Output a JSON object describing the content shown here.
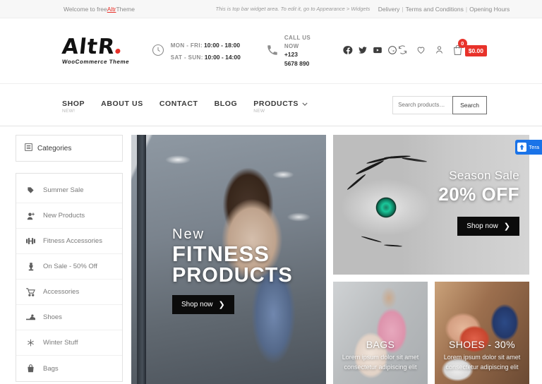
{
  "topbar": {
    "left_prefix": "Welcome to free ",
    "left_link": "Altr",
    "left_suffix": " Theme",
    "middle": "This is top bar widget area. To edit it, go to Appearance > Widgets",
    "links": [
      "Delivery",
      "Terms and Conditions",
      "Opening Hours"
    ]
  },
  "header": {
    "logo_main": "AltR",
    "logo_sub": "WooCommerce Theme",
    "hours": {
      "row1_label": "MON - FRI:",
      "row1_value": "10:00 - 18:00",
      "row2_label": "SAT - SUN:",
      "row2_value": "10:00 - 14:00"
    },
    "phone": {
      "label": "CALL US NOW",
      "value": "+123 5678 890"
    },
    "socials": [
      "facebook-icon",
      "twitter-icon",
      "youtube-icon",
      "whatsapp-icon"
    ],
    "actions": {
      "compare": "compare-icon",
      "wishlist": "heart-icon",
      "account": "user-icon",
      "cart": "cart-icon",
      "cart_count": "0",
      "cart_total": "$0.00"
    }
  },
  "nav": {
    "items": [
      {
        "label": "SHOP",
        "badge": "NEW!",
        "dropdown": false
      },
      {
        "label": "ABOUT US",
        "badge": "",
        "dropdown": false
      },
      {
        "label": "CONTACT",
        "badge": "",
        "dropdown": false
      },
      {
        "label": "BLOG",
        "badge": "",
        "dropdown": false
      },
      {
        "label": "PRODUCTS",
        "badge": "NEW",
        "dropdown": true
      }
    ],
    "chevron": "⌄"
  },
  "search": {
    "placeholder": "Search products…",
    "value": "",
    "button": "Search"
  },
  "sidebar": {
    "header": "Categories",
    "header_icon": "list-icon",
    "items": [
      {
        "label": "Summer Sale",
        "icon": "tag-icon",
        "glyph": "⚑"
      },
      {
        "label": "New Products",
        "icon": "user-plus-icon",
        "glyph": "♟"
      },
      {
        "label": "Fitness Accessories",
        "icon": "dumbbell-icon",
        "glyph": "‖"
      },
      {
        "label": "On Sale - 50% Off",
        "icon": "trophy-icon",
        "glyph": "♟"
      },
      {
        "label": "Accessories",
        "icon": "cart-icon",
        "glyph": "⛟"
      },
      {
        "label": "Shoes",
        "icon": "shoe-icon",
        "glyph": "❦"
      },
      {
        "label": "Winter Stuff",
        "icon": "snowflake-icon",
        "glyph": "❅"
      },
      {
        "label": "Bags",
        "icon": "bag-icon",
        "glyph": "▮"
      }
    ]
  },
  "hero": {
    "eyebrow": "New",
    "line1": "FITNESS",
    "line2": "PRODUCTS",
    "cta": "Shop now",
    "cta_arrow": "❯"
  },
  "season": {
    "title": "Season Sale",
    "discount": "20% OFF",
    "cta": "Shop now",
    "cta_arrow": "❯"
  },
  "promo_cards": [
    {
      "title": "BAGS",
      "desc": "Lorem ipsum dolor sit amet consectetur adipiscing elit"
    },
    {
      "title": "SHOES - 30%",
      "desc": "Lorem ipsum dolor sit amet consectetur adipiscing elit"
    }
  ],
  "float_tab": {
    "label": "Tera",
    "icon": "upload-arrow-icon"
  },
  "colors": {
    "accent_red": "#e8322a",
    "dark_button": "#0b0b0b",
    "topbar_bg": "#f7f7f7",
    "float_blue": "#1a73e8"
  }
}
